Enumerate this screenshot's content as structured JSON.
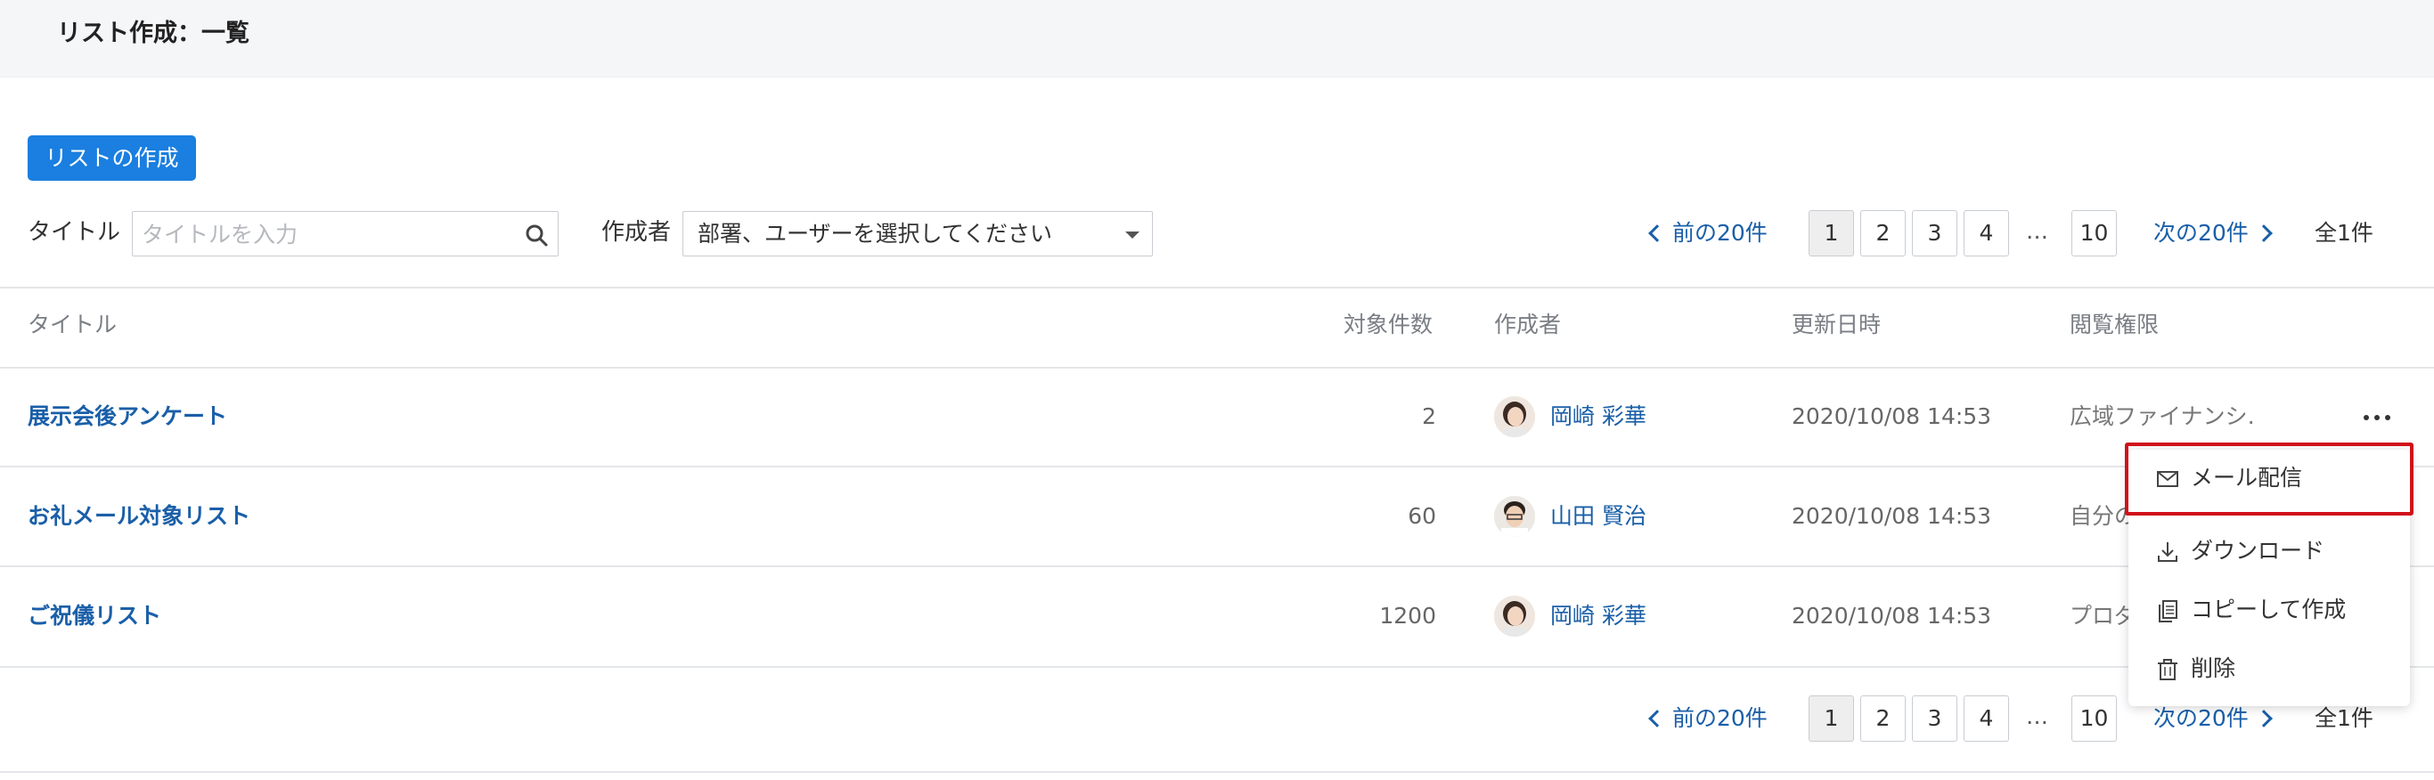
{
  "header": {
    "title": "リスト作成：一覧"
  },
  "toolbar": {
    "create_label": "リストの作成",
    "title_filter_label": "タイトル",
    "title_placeholder": "タイトルを入力",
    "author_filter_label": "作成者",
    "author_select_value": "部署、ユーザーを選択してください"
  },
  "pager": {
    "prev_label": "前の20件",
    "next_label": "次の20件",
    "pages": [
      "1",
      "2",
      "3",
      "4"
    ],
    "ellipsis": "…",
    "last_page": "10",
    "active_page": "1",
    "total": "全1件"
  },
  "table": {
    "columns": [
      "タイトル",
      "対象件数",
      "作成者",
      "更新日時",
      "閲覧権限"
    ],
    "rows": [
      {
        "title": "展示会後アンケート",
        "count": "2",
        "author": "岡崎 彩華",
        "updated": "2020/10/08 14:53",
        "permission": "広域ファイナンシ…"
      },
      {
        "title": "お礼メール対象リスト",
        "count": "60",
        "author": "山田 賢治",
        "updated": "2020/10/08 14:53",
        "permission": "自分の"
      },
      {
        "title": "ご祝儀リスト",
        "count": "1200",
        "author": "岡崎 彩華",
        "updated": "2020/10/08 14:53",
        "permission": "プロダ"
      }
    ]
  },
  "context_menu": {
    "items": [
      {
        "label": "メール配信",
        "icon": "mail-icon"
      },
      {
        "label": "ダウンロード",
        "icon": "download-icon"
      },
      {
        "label": "コピーして作成",
        "icon": "copy-icon"
      },
      {
        "label": "削除",
        "icon": "trash-icon"
      }
    ],
    "highlight_color": "#d0101b"
  },
  "colors": {
    "accent": "#1a7fe0",
    "link": "#1a5fa8"
  }
}
